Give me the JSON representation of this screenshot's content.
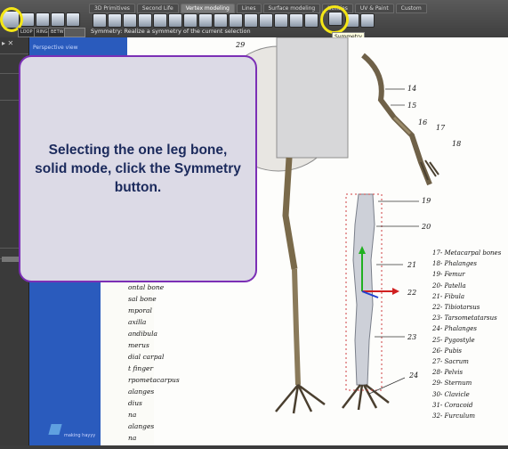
{
  "toolbar": {
    "tabs": [
      "3D Primitives",
      "Second Life",
      "Vertex modeling",
      "Lines",
      "Surface modeling",
      "Utilities",
      "UV & Paint",
      "Custom"
    ],
    "active_tab": "Vertex modeling",
    "left_buttons": [
      "LOOP",
      "RING",
      "BETW"
    ],
    "hint": "Symmetry: Realize a symmetry of the current selection",
    "tooltip": "Symmetry",
    "highlight_color": "#f4e616"
  },
  "viewport": {
    "title": "Perspective view",
    "logo": "making hayyy"
  },
  "callout": {
    "text": "Selecting the one leg bone, solid mode, click the Symmetry button.",
    "border_color": "#7b2fb5",
    "text_color": "#1b2a5c"
  },
  "figure": {
    "left_labels": [
      "ontal bone",
      "sal bone",
      "mporal",
      "axilla",
      "andibula",
      "merus",
      "dial carpal",
      "t finger",
      "rpometacarpus",
      "alanges",
      "dius",
      "na",
      "alanges",
      "na"
    ],
    "numbers": [
      "29",
      "14",
      "15",
      "16",
      "17",
      "18",
      "19",
      "20",
      "21",
      "22",
      "23",
      "24"
    ],
    "legend": [
      "17- Metacarpal bones",
      "18- Phalanges",
      "19- Femur",
      "20- Patella",
      "21- Fibula",
      "22- Tibiotarsus",
      "23- Tarsometatarsus",
      "24- Phalanges",
      "25- Pygostyle",
      "26- Pubis",
      "27- Sacrum",
      "28- Pelvis",
      "29- Sternum",
      "30- Clavicle",
      "31- Coracoid",
      "32- Furculum"
    ]
  }
}
